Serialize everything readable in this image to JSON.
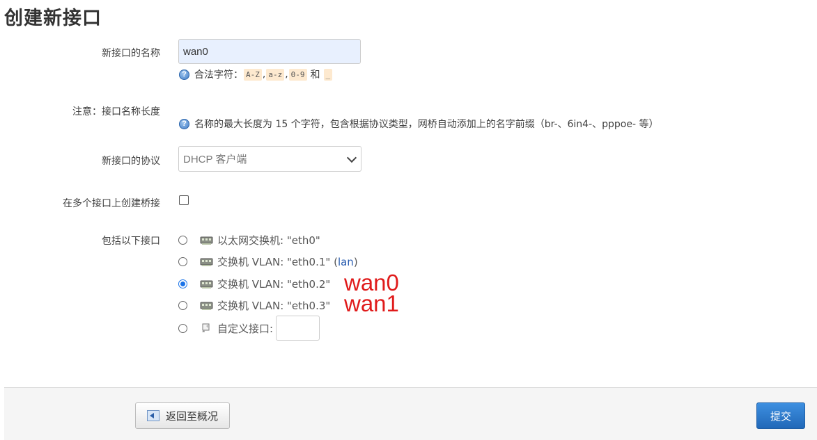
{
  "page_title": "创建新接口",
  "name_field": {
    "label": "新接口的名称",
    "value": "wan0",
    "hint_prefix": "合法字符：",
    "chars": [
      "A-Z",
      "a-z",
      "0-9"
    ],
    "sep": ",",
    "and": "和",
    "underscore": "_"
  },
  "note": {
    "label": "注意：接口名称长度",
    "text": "名称的最大长度为 15 个字符，包含根据协议类型，网桥自动添加上的名字前缀（br-、6in4-、pppoe- 等）"
  },
  "protocol": {
    "label": "新接口的协议",
    "selected": "DHCP 客户端"
  },
  "bridge": {
    "label": "在多个接口上创建桥接",
    "checked": false
  },
  "interfaces": {
    "label": "包括以下接口",
    "options": [
      {
        "text": "以太网交换机: \"eth0\"",
        "suffix": "",
        "selected": false,
        "icon": "ethernet-switch-icon"
      },
      {
        "text": "交换机 VLAN: \"eth0.1\" (",
        "suffix": "lan",
        "close": ")",
        "selected": false,
        "icon": "ethernet-switch-icon"
      },
      {
        "text": "交换机 VLAN: \"eth0.2\"",
        "suffix": "",
        "selected": true,
        "icon": "ethernet-switch-icon"
      },
      {
        "text": "交换机 VLAN: \"eth0.3\"",
        "suffix": "",
        "selected": false,
        "icon": "ethernet-switch-icon"
      },
      {
        "text": "自定义接口:",
        "suffix": "",
        "selected": false,
        "icon": "custom-interface-icon"
      }
    ]
  },
  "annotations": [
    "wan0",
    "wan1"
  ],
  "footer": {
    "back_label": "返回至概况",
    "submit_label": "提交"
  },
  "colors": {
    "annotation": "#e01b1b",
    "primary": "#2168b8",
    "link": "#2a5db0"
  }
}
